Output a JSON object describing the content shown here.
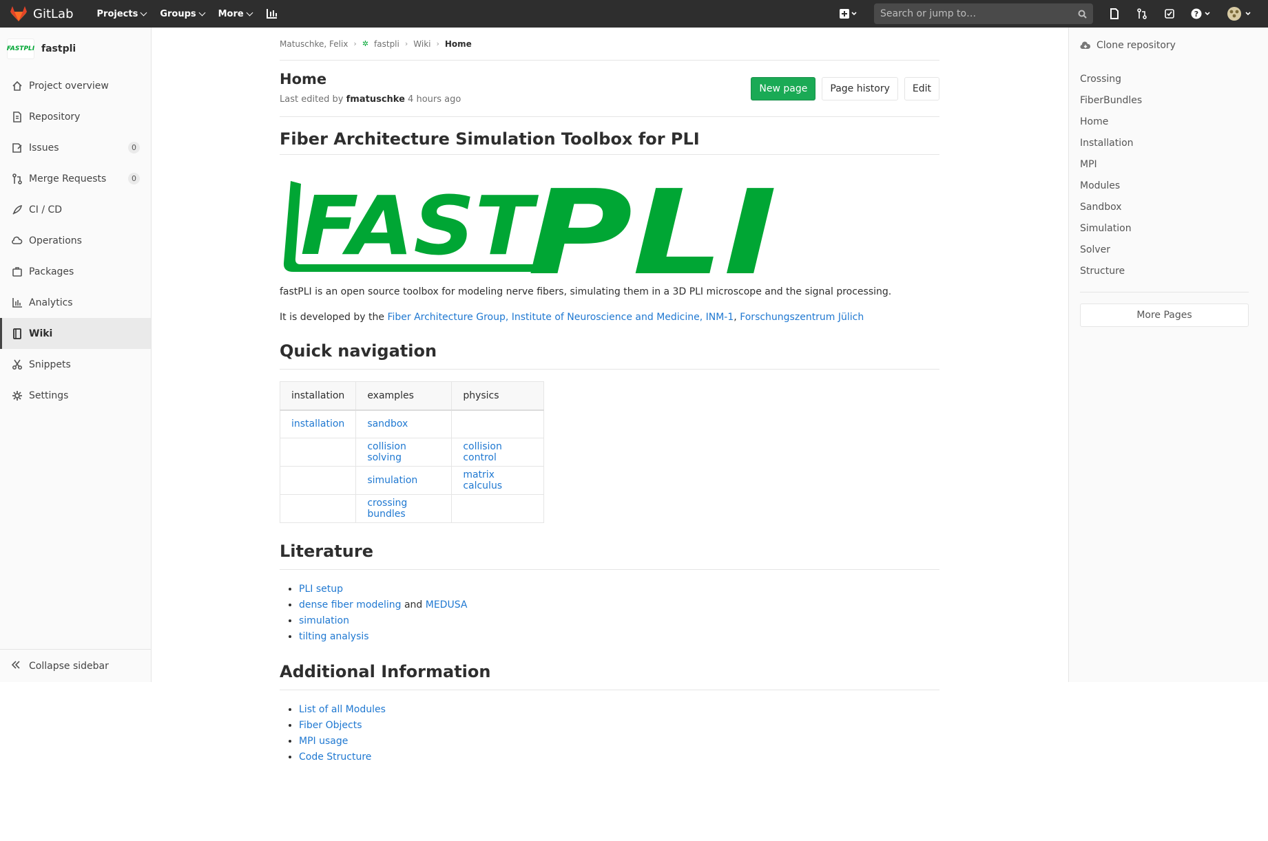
{
  "topbar": {
    "brand": "GitLab",
    "menu": [
      "Projects",
      "Groups",
      "More"
    ],
    "search_placeholder": "Search or jump to…"
  },
  "sidebar": {
    "project_logo_text": "FASTPLI",
    "project_name": "fastpli",
    "items": [
      {
        "label": "Project overview",
        "icon": "home-icon"
      },
      {
        "label": "Repository",
        "icon": "doc-icon"
      },
      {
        "label": "Issues",
        "icon": "issues-icon",
        "count": "0"
      },
      {
        "label": "Merge Requests",
        "icon": "merge-icon",
        "count": "0"
      },
      {
        "label": "CI / CD",
        "icon": "rocket-icon"
      },
      {
        "label": "Operations",
        "icon": "cloud-icon"
      },
      {
        "label": "Packages",
        "icon": "package-icon"
      },
      {
        "label": "Analytics",
        "icon": "chart-icon"
      },
      {
        "label": "Wiki",
        "icon": "book-icon",
        "active": true
      },
      {
        "label": "Snippets",
        "icon": "scissors-icon"
      },
      {
        "label": "Settings",
        "icon": "gear-icon"
      }
    ],
    "collapse_label": "Collapse sidebar"
  },
  "breadcrumb": [
    "Matuschke, Felix",
    "fastpli",
    "Wiki",
    "Home"
  ],
  "page": {
    "title": "Home",
    "meta_prefix": "Last edited by",
    "meta_user": "fmatuschke",
    "meta_time": "4 hours ago",
    "buttons": {
      "new_page": "New page",
      "history": "Page history",
      "edit": "Edit"
    }
  },
  "content": {
    "h1": "Fiber Architecture Simulation Toolbox for PLI",
    "logo_text": {
      "fast": "FAST",
      "pli": "PLI"
    },
    "intro": "fastPLI is an open source toolbox for modeling nerve fibers, simulating them in a 3D PLI microscope and the signal processing.",
    "dev_prefix": "It is developed by the",
    "dev_link1": "Fiber Architecture Group, Institute of Neuroscience and Medicine, INM-1",
    "dev_comma": ",",
    "dev_link2": "Forschungszentrum Jülich",
    "quick_nav_title": "Quick navigation",
    "table": {
      "headers": [
        "installation",
        "examples",
        "physics"
      ],
      "rows": [
        [
          "installation",
          "sandbox",
          ""
        ],
        [
          "",
          "collision solving",
          "collision control"
        ],
        [
          "",
          "simulation",
          "matrix calculus"
        ],
        [
          "",
          "crossing bundles",
          ""
        ]
      ]
    },
    "literature_title": "Literature",
    "literature": {
      "item1": "PLI setup",
      "item2a": "dense fiber modeling",
      "item2_and": "and",
      "item2b": "MEDUSA",
      "item3": "simulation",
      "item4": "tilting analysis"
    },
    "additional_title": "Additional Information",
    "additional": [
      "List of all Modules",
      "Fiber Objects",
      "MPI usage",
      "Code Structure"
    ]
  },
  "rsidebar": {
    "clone_label": "Clone repository",
    "pages": [
      "Crossing",
      "FiberBundles",
      "Home",
      "Installation",
      "MPI",
      "Modules",
      "Sandbox",
      "Simulation",
      "Solver",
      "Structure"
    ],
    "more_pages": "More Pages"
  },
  "colors": {
    "topbar": "#2e2e2e",
    "link": "#1f78d1",
    "green_button": "#1aaa55",
    "logo_green": "#00a634",
    "gitlab_orange": "#e24329"
  }
}
